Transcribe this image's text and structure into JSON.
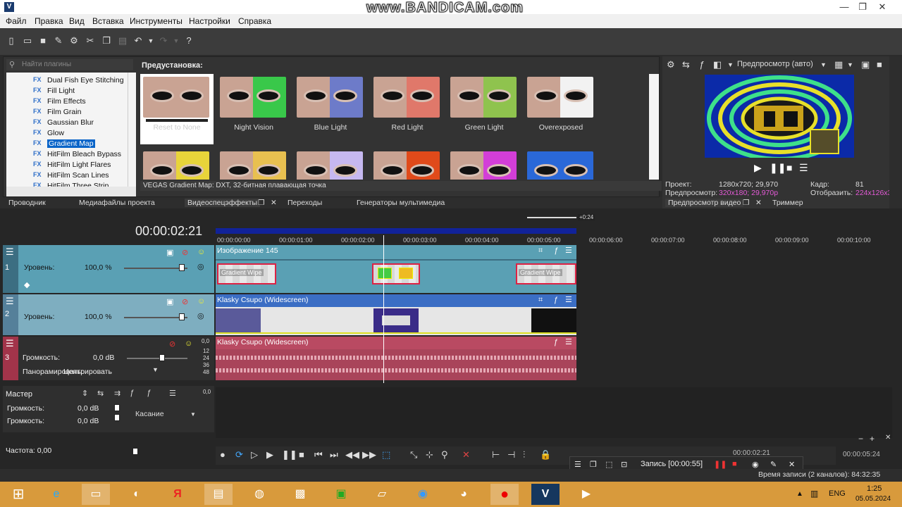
{
  "window": {
    "app_icon": "V",
    "watermark": "www.BANDICAM.com",
    "controls": [
      "—",
      "❐",
      "✕"
    ]
  },
  "menu": [
    "Файл",
    "Правка",
    "Вид",
    "Вставка",
    "Инструменты",
    "Настройки",
    "Справка"
  ],
  "plugins": {
    "search_placeholder": "Найти плагины",
    "items": [
      {
        "fx": "FX",
        "label": "Dual Fish Eye Stitching"
      },
      {
        "fx": "FX",
        "label": "Fill Light"
      },
      {
        "fx": "FX",
        "label": "Film Effects"
      },
      {
        "fx": "FX",
        "label": "Film Grain"
      },
      {
        "fx": "FX",
        "label": "Gaussian Blur"
      },
      {
        "fx": "FX",
        "label": "Glow"
      },
      {
        "fx": "FX",
        "label": "Gradient Map"
      },
      {
        "fx": "FX",
        "label": "HitFilm Bleach Bypass"
      },
      {
        "fx": "FX",
        "label": "HitFilm Light Flares"
      },
      {
        "fx": "FX",
        "label": "HitFilm Scan Lines"
      },
      {
        "fx": "FX",
        "label": "HitFilm Three Strip Color"
      }
    ],
    "selected_index": 6
  },
  "presets": {
    "title": "Предустановка:",
    "row1": [
      {
        "label": "Reset to None",
        "tint": "#c9a393",
        "tint2": "#c9a393"
      },
      {
        "label": "Night Vision",
        "tint": "#c9a393",
        "tint2": "#39c84a"
      },
      {
        "label": "Blue Light",
        "tint": "#c9a393",
        "tint2": "#6d7bc9"
      },
      {
        "label": "Red  Light",
        "tint": "#c9a393",
        "tint2": "#e0786a"
      },
      {
        "label": "Green  Light",
        "tint": "#c9a393",
        "tint2": "#8fc34e"
      },
      {
        "label": "Overexposed",
        "tint": "#c9a393",
        "tint2": "#f2f2f2"
      }
    ],
    "row2": [
      {
        "tint": "#c9a393",
        "tint2": "#e8d43a"
      },
      {
        "tint": "#c9a393",
        "tint2": "#e8c050"
      },
      {
        "tint": "#c9a393",
        "tint2": "#c6b8f0"
      },
      {
        "tint": "#c9a393",
        "tint2": "#e04a1a"
      },
      {
        "tint": "#c9a393",
        "tint2": "#d33ed8"
      },
      {
        "tint": "#2a68d8",
        "tint2": "#2a68d8"
      }
    ],
    "status": "VEGAS Gradient Map: DXT, 32-битная плавающая точка"
  },
  "bottom_tabs": [
    "Проводник",
    "Медиафайлы проекта",
    "Видеоспецэффекты",
    "Переходы",
    "Генераторы мультимедиа"
  ],
  "preview": {
    "mode": "Предпросмотр (авто)",
    "project_label": "Проект:",
    "project_value": "1280x720; 29,970",
    "preview_label": "Предпросмотр:",
    "preview_value": "320x180; 29,970p",
    "frame_label": "Кадр:",
    "frame_value": "81",
    "display_label": "Отобразить:",
    "display_value": "224x126x32",
    "tabs": [
      "Предпросмотр видео",
      "Триммер"
    ]
  },
  "timeline": {
    "timecode": "00:00:02:21",
    "marker": "+0:24",
    "ruler": [
      "00:00:00:00",
      "00:00:01:00",
      "00:00:02:00",
      "00:00:03:00",
      "00:00:04:00",
      "00:00:05:00",
      "00:00:06:00",
      "00:00:07:00",
      "00:00:08:00",
      "00:00:09:00",
      "00:00:10:00"
    ],
    "tracks": [
      {
        "num": "1",
        "level_label": "Уровень:",
        "level_value": "100,0 %",
        "clip": "Изображение 145",
        "transition": "Gradient Wipe"
      },
      {
        "num": "2",
        "level_label": "Уровень:",
        "level_value": "100,0 %",
        "clip": "Klasky Csupo (Widescreen)"
      },
      {
        "num": "3",
        "vol_label": "Громкость:",
        "vol_value": "0,0 dB",
        "pan_label": "Панорамировать:",
        "pan_value": "Центрировать",
        "clip": "Klasky Csupo (Widescreen)"
      }
    ],
    "db_scale": [
      "0,0",
      "12",
      "24",
      "36",
      "48"
    ],
    "master": {
      "title": "Мастер",
      "vol1_label": "Громкость:",
      "vol1_value": "0,0 dB",
      "vol2_label": "Громкость:",
      "vol2_value": "0,0 dB",
      "touch": "Касание",
      "freq": "Частота: 0,00"
    },
    "record": "Запись [00:00:55]",
    "end_time": "00:00:05:24",
    "transport_time": "00:00:02:21"
  },
  "statusbar": {
    "record_time": "Время записи (2 каналов): 84:32:35"
  },
  "taskbar": {
    "lang": "ENG",
    "time": "1:25",
    "date": "05.05.2024"
  }
}
